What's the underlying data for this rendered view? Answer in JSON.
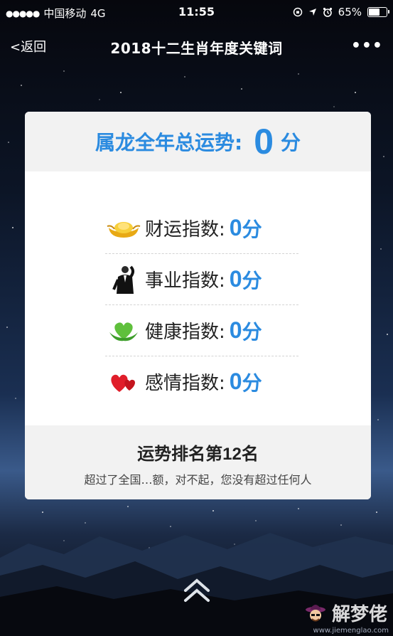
{
  "status_bar": {
    "signal": "●●●●●",
    "carrier": "中国移动",
    "network": "4G",
    "time": "11:55",
    "battery": "65%"
  },
  "nav": {
    "back_label": "<返回",
    "title": "2018十二生肖年度关键词",
    "more": "•••"
  },
  "card": {
    "header": {
      "label": "属龙全年总运势:",
      "score": "0",
      "unit": "分"
    },
    "rows": [
      {
        "icon": "gold-ingot-icon",
        "label": "财运指数:",
        "value": "0",
        "unit": "分"
      },
      {
        "icon": "businessman-icon",
        "label": "事业指数:",
        "value": "0",
        "unit": "分"
      },
      {
        "icon": "health-heart-icon",
        "label": "健康指数:",
        "value": "0",
        "unit": "分"
      },
      {
        "icon": "love-hearts-icon",
        "label": "感情指数:",
        "value": "0",
        "unit": "分"
      }
    ],
    "footer": {
      "rank_prefix": "运势排名第",
      "rank_number": "12",
      "rank_suffix": "名",
      "subtitle": "超过了全国…额，对不起，您没有超过任何人"
    }
  },
  "watermark": {
    "text": "解梦佬",
    "url": "www.jiemenglao.com"
  },
  "colors": {
    "accent": "#2b8be0",
    "card_bg": "#ffffff",
    "card_band": "#f2f2f2"
  }
}
